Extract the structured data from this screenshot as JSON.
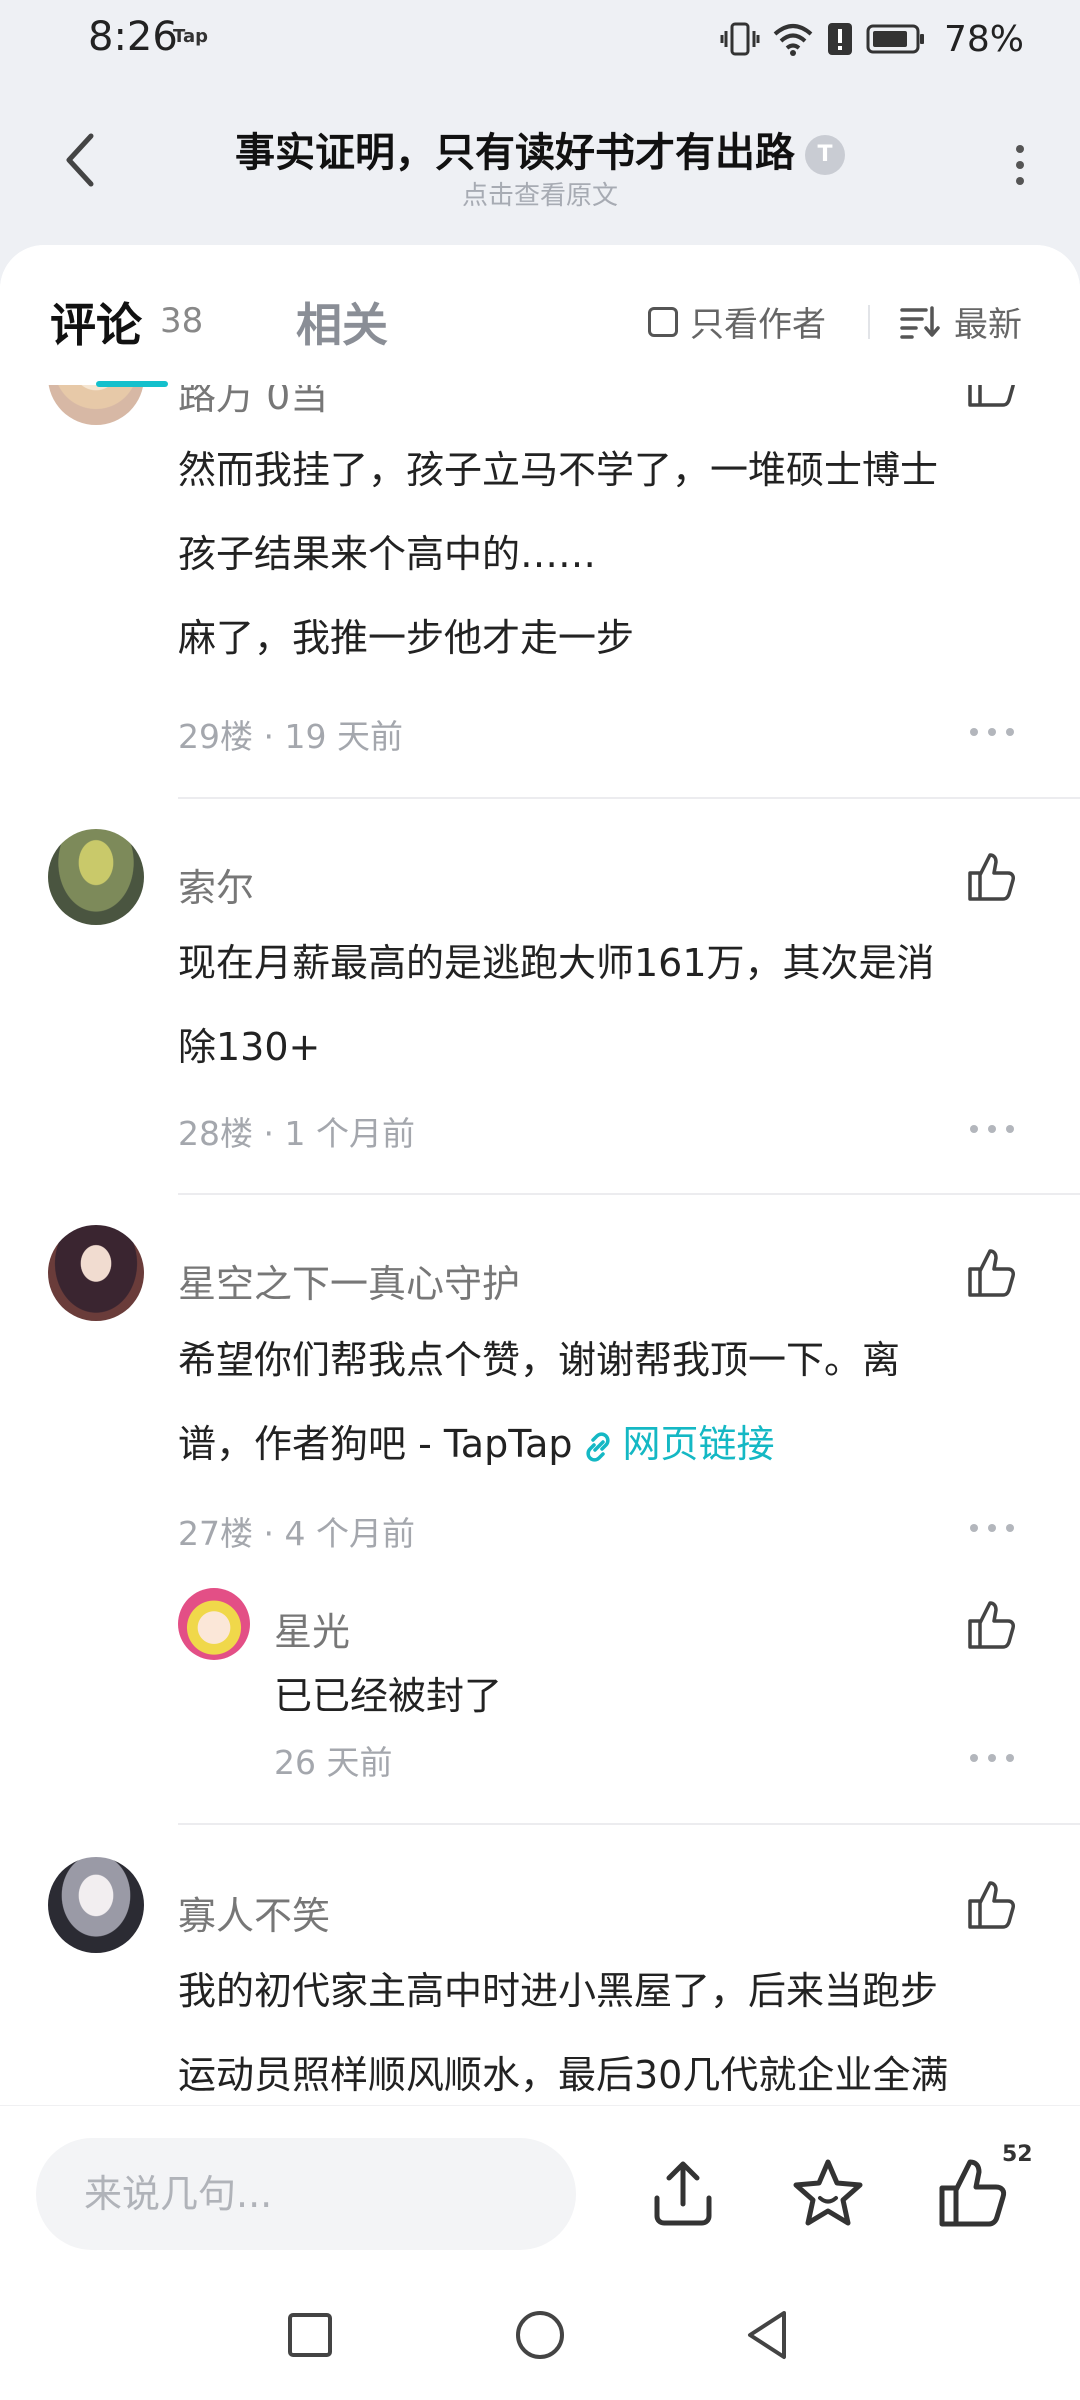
{
  "status_bar": {
    "time": "8:26",
    "app_tag": "Tap",
    "battery": "78%"
  },
  "header": {
    "title": "事实证明，只有读好书才有出路",
    "badge": "T",
    "subtitle": "点击查看原文"
  },
  "tabs": {
    "comments_label": "评论",
    "comments_count": "38",
    "related_label": "相关",
    "author_only_label": "只看作者",
    "sort_label": "最新"
  },
  "comments": [
    {
      "name_partial": "路万 0当",
      "lines": [
        "然而我挂了，孩子立马不学了，一堆硕士博士",
        "孩子结果来个高中的……",
        "麻了，我推一步他才走一步"
      ],
      "floor": "29楼",
      "time": "19 天前"
    },
    {
      "name": "索尔",
      "lines": [
        "现在月薪最高的是逃跑大师161万，其次是消",
        "除130+"
      ],
      "floor": "28楼",
      "time": "1 个月前"
    },
    {
      "name": "星空之下一真心守护",
      "lines": [
        "希望你们帮我点个赞，谢谢帮我顶一下。离",
        "谱，作者狗吧 - TapTap"
      ],
      "link_text": "网页链接",
      "floor": "27楼",
      "time": "4 个月前",
      "reply": {
        "name": "星光",
        "text": "已已经被封了",
        "time": "26 天前"
      }
    },
    {
      "name": "寡人不笑",
      "lines": [
        "我的初代家主高中时进小黑屋了，后来当跑步",
        "运动员照样顺风顺水，最后30几代就企业全满"
      ]
    }
  ],
  "bottom_bar": {
    "input_placeholder": "来说几句...",
    "like_count": "52"
  },
  "colors": {
    "accent": "#14c0cc",
    "page_bg": "#eef0f4"
  }
}
